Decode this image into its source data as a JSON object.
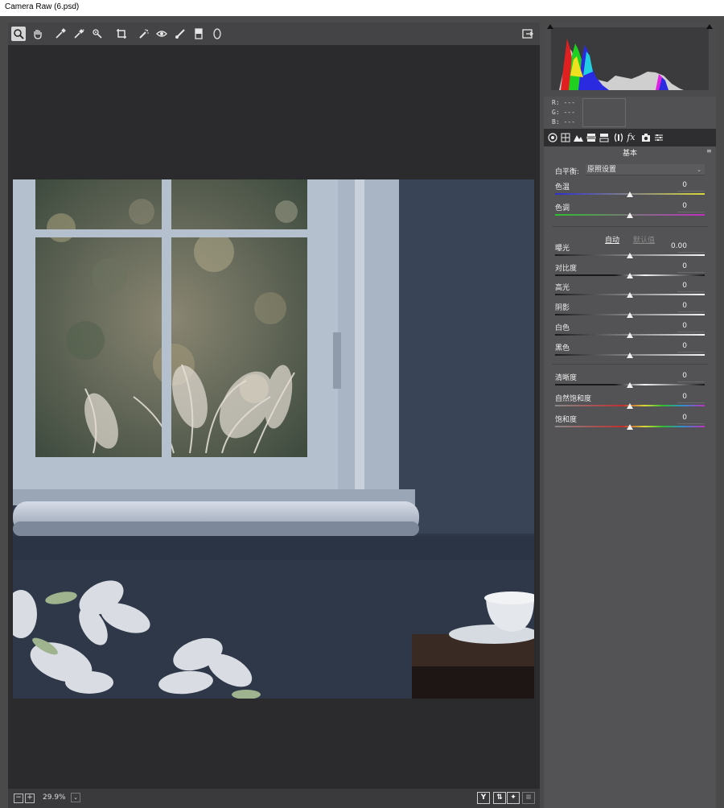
{
  "window": {
    "title": "Camera Raw (6.psd)"
  },
  "toolbar": {
    "tools": [
      "zoom-tool-icon",
      "hand-tool-icon",
      "white-balance-tool-icon",
      "color-sampler-tool-icon",
      "targeted-adjustment-tool-icon",
      "crop-tool-icon",
      "spot-removal-tool-icon",
      "red-eye-removal-tool-icon",
      "adjustment-brush-icon",
      "graduated-filter-icon",
      "radial-filter-icon"
    ],
    "open_preferences": "open-in-photoshop-icon"
  },
  "status": {
    "zoom": "29.9%"
  },
  "histogram": {
    "r": "R:  ---",
    "g": "G:  ---",
    "b": "B:  ---"
  },
  "panel": {
    "section_title": "基本",
    "white_balance_label": "白平衡:",
    "white_balance_value": "原照设置",
    "auto_label": "自动",
    "default_label": "默认值",
    "sliders": [
      {
        "label": "色温",
        "value": "0",
        "level": 0.5
      },
      {
        "label": "色调",
        "value": "0",
        "level": 0.5
      },
      {
        "label": "曝光",
        "value": "0.00",
        "level": 0.5
      },
      {
        "label": "对比度",
        "value": "0",
        "level": 0.5
      },
      {
        "label": "高光",
        "value": "0",
        "level": 0.5
      },
      {
        "label": "阴影",
        "value": "0",
        "level": 0.5
      },
      {
        "label": "白色",
        "value": "0",
        "level": 0.5
      },
      {
        "label": "黑色",
        "value": "0",
        "level": 0.5
      },
      {
        "label": "清晰度",
        "value": "0",
        "level": 0.5
      },
      {
        "label": "自然饱和度",
        "value": "0",
        "level": 0.5
      },
      {
        "label": "饱和度",
        "value": "0",
        "level": 0.5
      }
    ]
  },
  "colors": {
    "accent": "#f0f0f0",
    "panel_bg": "#535355",
    "canvas_bg": "#2b2b2d"
  }
}
